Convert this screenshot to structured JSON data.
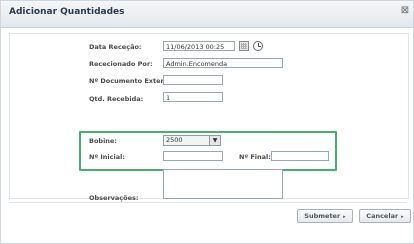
{
  "dialog": {
    "title": "Adicionar Quantidades",
    "close_glyph": "⊠"
  },
  "form": {
    "data_rececao": {
      "label": "Data Receção:",
      "value": "11/06/2013 00:25"
    },
    "rececionado_por": {
      "label": "Rececionado Por:",
      "value": "Admin.Encomenda"
    },
    "documento_externo": {
      "label": "Nº Documento Externo:",
      "value": ""
    },
    "qtd_recebida": {
      "label": "Qtd. Recebida:",
      "value": "1"
    },
    "bobine": {
      "label": "Bobine:",
      "value": "2500",
      "arrow": "▼"
    },
    "n_inicial": {
      "label": "Nº Inicial:",
      "value": ""
    },
    "n_final": {
      "label": "Nº Final:",
      "value": ""
    },
    "observacoes": {
      "label": "Observações:",
      "value": ""
    }
  },
  "buttons": {
    "submit_label": "Submeter",
    "cancel_label": "Cancelar",
    "caret": "▸"
  },
  "icons": [
    "calendar-icon",
    "clock-icon",
    "close-icon",
    "chevron-down-icon"
  ],
  "colors": {
    "highlight": "#45b06b"
  }
}
